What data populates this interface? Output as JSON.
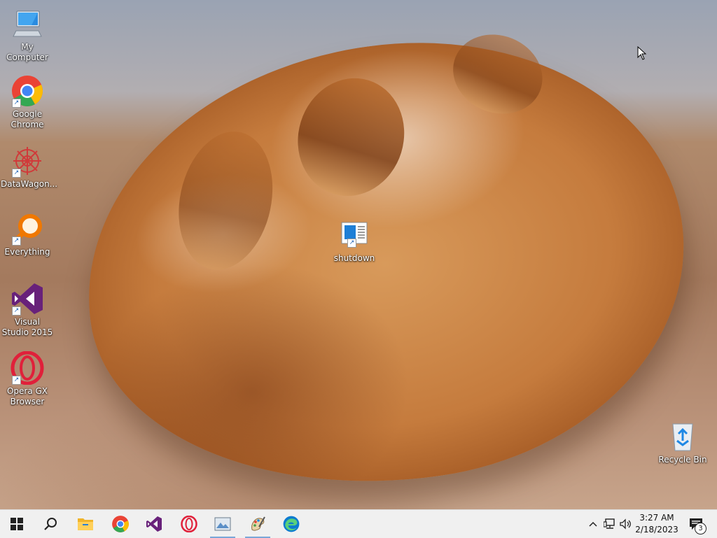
{
  "desktop": {
    "icons": [
      {
        "label": "My Computer",
        "icon": "computer-icon"
      },
      {
        "label": "Google Chrome",
        "icon": "chrome-icon"
      },
      {
        "label": "DataWagon...",
        "icon": "datawagon-icon"
      },
      {
        "label": "Everything",
        "icon": "everything-search-icon"
      },
      {
        "label": "Visual Studio 2015",
        "icon": "visual-studio-icon"
      },
      {
        "label": "Opera GX Browser",
        "icon": "opera-gx-icon"
      },
      {
        "label": "shutdown",
        "icon": "shutdown-file-icon"
      },
      {
        "label": "Recycle Bin",
        "icon": "recycle-bin-icon"
      }
    ]
  },
  "taskbar": {
    "pinned": [
      {
        "name": "start",
        "icon": "windows-start-icon"
      },
      {
        "name": "search",
        "icon": "search-icon"
      },
      {
        "name": "file-explorer",
        "icon": "folder-icon"
      },
      {
        "name": "chrome",
        "icon": "chrome-icon"
      },
      {
        "name": "visual-studio",
        "icon": "visual-studio-icon"
      },
      {
        "name": "opera",
        "icon": "opera-icon"
      },
      {
        "name": "app-window",
        "icon": "image-viewer-icon"
      },
      {
        "name": "paint",
        "icon": "paint-icon"
      },
      {
        "name": "edge",
        "icon": "edge-icon"
      }
    ],
    "tray": {
      "time": "3:27 AM",
      "date": "2/18/2023",
      "notification_count": "3"
    }
  },
  "colors": {
    "taskbar_bg": "#f0f0f0",
    "chrome_red": "#ea4335",
    "chrome_green": "#34a853",
    "chrome_yellow": "#fbbc05",
    "chrome_blue": "#4285f4",
    "vs_purple": "#68217a",
    "opera_red": "#e0203a"
  }
}
